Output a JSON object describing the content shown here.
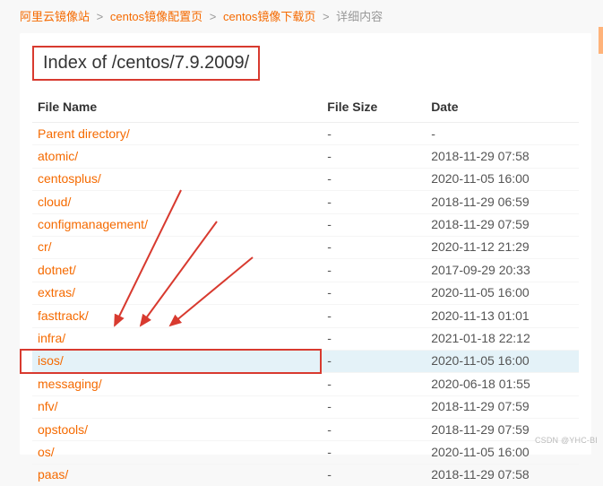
{
  "breadcrumb": {
    "items": [
      {
        "label": "阿里云镜像站",
        "link": true
      },
      {
        "label": "centos镜像配置页",
        "link": true
      },
      {
        "label": "centos镜像下载页",
        "link": true
      },
      {
        "label": "详细内容",
        "link": false
      }
    ],
    "separator": ">"
  },
  "page_title": "Index of /centos/7.9.2009/",
  "columns": {
    "name": "File Name",
    "size": "File Size",
    "date": "Date"
  },
  "rows": [
    {
      "name": "Parent directory/",
      "size": "-",
      "date": "-",
      "highlight": false
    },
    {
      "name": "atomic/",
      "size": "-",
      "date": "2018-11-29 07:58",
      "highlight": false
    },
    {
      "name": "centosplus/",
      "size": "-",
      "date": "2020-11-05 16:00",
      "highlight": false
    },
    {
      "name": "cloud/",
      "size": "-",
      "date": "2018-11-29 06:59",
      "highlight": false
    },
    {
      "name": "configmanagement/",
      "size": "-",
      "date": "2018-11-29 07:59",
      "highlight": false
    },
    {
      "name": "cr/",
      "size": "-",
      "date": "2020-11-12 21:29",
      "highlight": false
    },
    {
      "name": "dotnet/",
      "size": "-",
      "date": "2017-09-29 20:33",
      "highlight": false
    },
    {
      "name": "extras/",
      "size": "-",
      "date": "2020-11-05 16:00",
      "highlight": false
    },
    {
      "name": "fasttrack/",
      "size": "-",
      "date": "2020-11-13 01:01",
      "highlight": false
    },
    {
      "name": "infra/",
      "size": "-",
      "date": "2021-01-18 22:12",
      "highlight": false
    },
    {
      "name": "isos/",
      "size": "-",
      "date": "2020-11-05 16:00",
      "highlight": true
    },
    {
      "name": "messaging/",
      "size": "-",
      "date": "2020-06-18 01:55",
      "highlight": false
    },
    {
      "name": "nfv/",
      "size": "-",
      "date": "2018-11-29 07:59",
      "highlight": false
    },
    {
      "name": "opstools/",
      "size": "-",
      "date": "2018-11-29 07:59",
      "highlight": false
    },
    {
      "name": "os/",
      "size": "-",
      "date": "2020-11-05 16:00",
      "highlight": false
    },
    {
      "name": "paas/",
      "size": "-",
      "date": "2018-11-29 07:58",
      "highlight": false
    }
  ],
  "watermark": "CSDN @YHC-BI"
}
